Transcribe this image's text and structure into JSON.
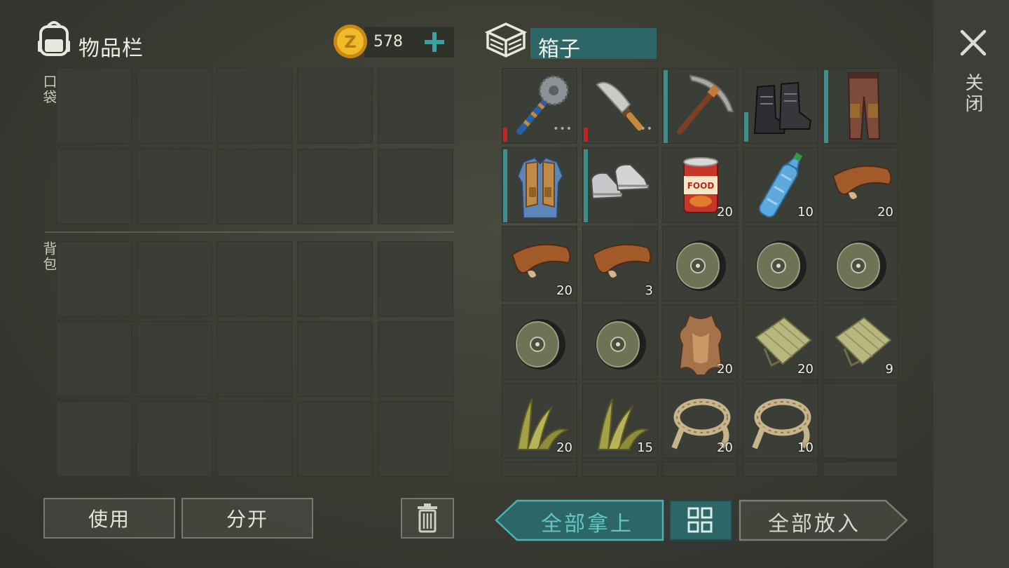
{
  "inventory": {
    "title": "物品栏",
    "pocket_label": "口袋",
    "backpack_label": "背包",
    "coins": "578"
  },
  "container": {
    "title": "箱子",
    "close_label": "关闭",
    "items": [
      {
        "name": "saw-mace",
        "icon": "saw-club-icon",
        "qty": "",
        "durability": "red",
        "dots": "•••"
      },
      {
        "name": "machete",
        "icon": "machete-icon",
        "qty": "",
        "durability": "red",
        "dots": "••"
      },
      {
        "name": "pickaxe",
        "icon": "pickaxe-icon",
        "qty": "",
        "durability": "teal",
        "dots": ""
      },
      {
        "name": "boots",
        "icon": "boots-icon",
        "qty": "",
        "durability": "teal",
        "dots": ""
      },
      {
        "name": "pants",
        "icon": "pants-icon",
        "qty": "",
        "durability": "teal",
        "dots": ""
      },
      {
        "name": "vest",
        "icon": "vest-icon",
        "qty": "",
        "durability": "teal",
        "dots": ""
      },
      {
        "name": "sneakers",
        "icon": "sneakers-icon",
        "qty": "",
        "durability": "teal",
        "dots": ""
      },
      {
        "name": "food-can",
        "icon": "food-can-icon",
        "qty": "20",
        "durability": "",
        "dots": ""
      },
      {
        "name": "water-bottle",
        "icon": "water-bottle-icon",
        "qty": "10",
        "durability": "",
        "dots": ""
      },
      {
        "name": "leather",
        "icon": "leather-icon",
        "qty": "20",
        "durability": "",
        "dots": ""
      },
      {
        "name": "leather",
        "icon": "leather-icon",
        "qty": "20",
        "durability": "",
        "dots": ""
      },
      {
        "name": "leather",
        "icon": "leather-icon",
        "qty": "3",
        "durability": "",
        "dots": ""
      },
      {
        "name": "wheel",
        "icon": "wheel-icon",
        "qty": "",
        "durability": "",
        "dots": ""
      },
      {
        "name": "wheel",
        "icon": "wheel-icon",
        "qty": "",
        "durability": "",
        "dots": ""
      },
      {
        "name": "wheel",
        "icon": "wheel-icon",
        "qty": "",
        "durability": "",
        "dots": ""
      },
      {
        "name": "wheel",
        "icon": "wheel-icon",
        "qty": "",
        "durability": "",
        "dots": ""
      },
      {
        "name": "wheel",
        "icon": "wheel-icon",
        "qty": "",
        "durability": "",
        "dots": ""
      },
      {
        "name": "hide",
        "icon": "animal-hide-icon",
        "qty": "20",
        "durability": "",
        "dots": ""
      },
      {
        "name": "cloth",
        "icon": "cloth-icon",
        "qty": "20",
        "durability": "",
        "dots": ""
      },
      {
        "name": "cloth",
        "icon": "cloth-icon",
        "qty": "9",
        "durability": "",
        "dots": ""
      },
      {
        "name": "plant-fiber",
        "icon": "grass-icon",
        "qty": "20",
        "durability": "",
        "dots": ""
      },
      {
        "name": "plant-fiber",
        "icon": "grass-icon",
        "qty": "15",
        "durability": "",
        "dots": ""
      },
      {
        "name": "rope",
        "icon": "rope-icon",
        "qty": "20",
        "durability": "",
        "dots": ""
      },
      {
        "name": "rope",
        "icon": "rope-icon",
        "qty": "10",
        "durability": "",
        "dots": ""
      },
      {
        "name": "empty",
        "icon": "",
        "qty": "",
        "durability": "",
        "dots": ""
      }
    ]
  },
  "buttons": {
    "use": "使用",
    "split": "分开",
    "take_all": "全部拿上",
    "put_all": "全部放入"
  },
  "colors": {
    "accent_teal": "#2c6667",
    "durability_red": "#b52a22",
    "durability_teal": "#3f8d8d",
    "coin_gold": "#e3a81b"
  }
}
